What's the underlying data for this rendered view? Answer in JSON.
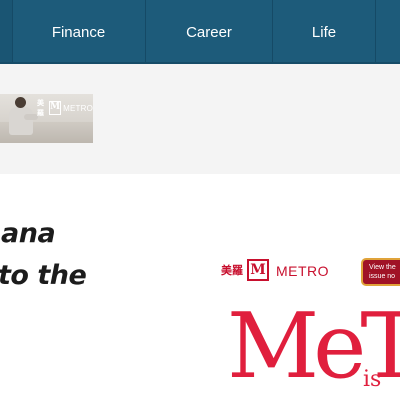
{
  "nav": {
    "items": [
      {
        "label": "Finance"
      },
      {
        "label": "Career"
      },
      {
        "label": "Life"
      }
    ]
  },
  "thumbnail": {
    "logo_cn": "美羅",
    "logo_mark": "M",
    "logo_text": "METRO"
  },
  "headline": {
    "line1": "ana",
    "line2": "to the"
  },
  "ad": {
    "logo_cn": "美羅",
    "logo_mark": "M",
    "logo_text": "METRO",
    "button_label": "View the issue no",
    "big_text": "MeT",
    "small_text": "is",
    "colors": {
      "brand": "#c8102e",
      "accent": "#e01f3d",
      "button": "#a01226"
    }
  },
  "colors": {
    "nav": "#1d5b7a",
    "band": "#f4f4f4"
  }
}
